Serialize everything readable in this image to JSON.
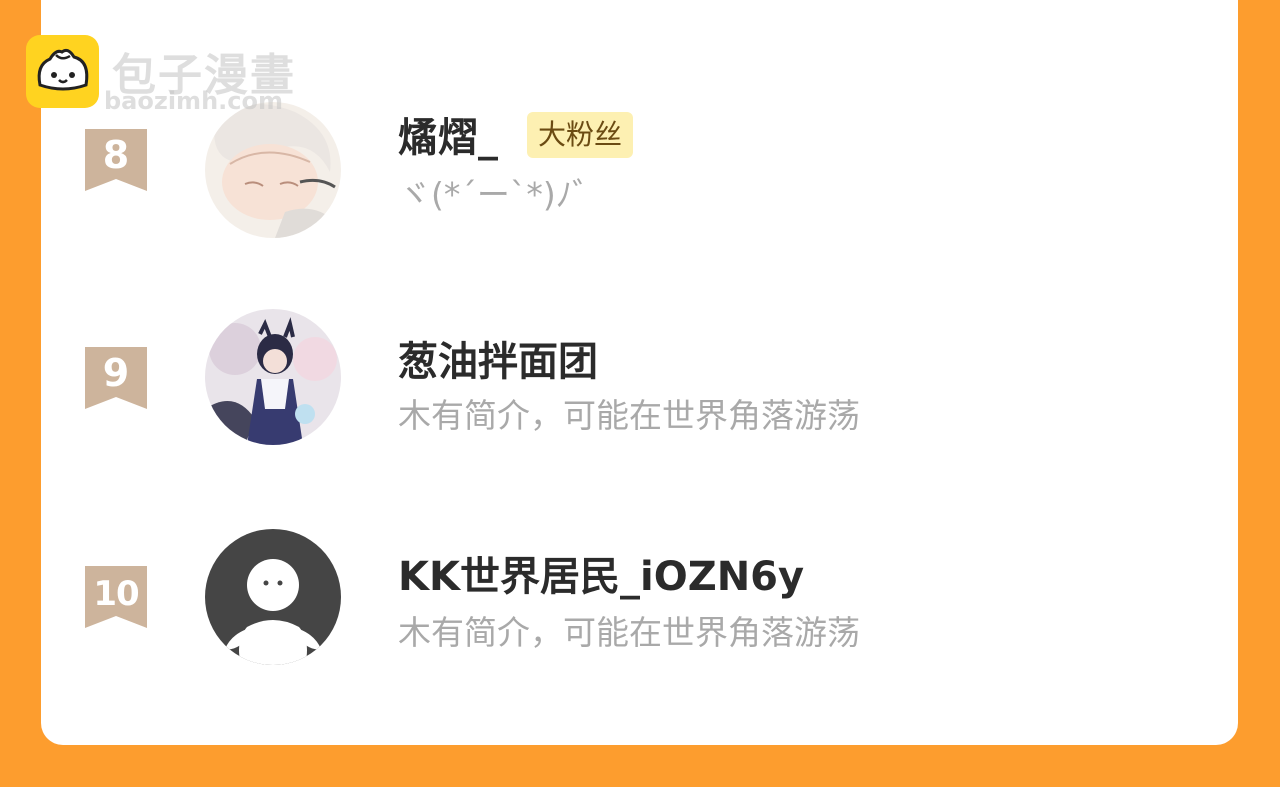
{
  "watermark": {
    "name_cn": "包子漫畫",
    "site": "baozimh.com",
    "icon": "bun-face-icon"
  },
  "ranking": [
    {
      "rank": "8",
      "name": "燏熠_",
      "badge": "大粉丝",
      "bio": "ヾ(*´ー`*)ﾉ゛",
      "avatar": "illustrated-avatar-white-hair"
    },
    {
      "rank": "9",
      "name": "葱油拌面团",
      "badge": "",
      "bio": "木有简介，可能在世界角落游荡",
      "avatar": "illustrated-avatar-dark-hair-girl"
    },
    {
      "rank": "10",
      "name": "KK世界居民_iOZN6y",
      "badge": "",
      "bio": "木有简介，可能在世界角落游荡",
      "avatar": "default-avatar-icon"
    }
  ],
  "colors": {
    "background": "#fd9d2e",
    "card": "#ffffff",
    "rank_badge": "#cdb49c",
    "badge_bg": "#fdf0b2",
    "name": "#2b2b2b",
    "bio": "#a9a9a9"
  }
}
